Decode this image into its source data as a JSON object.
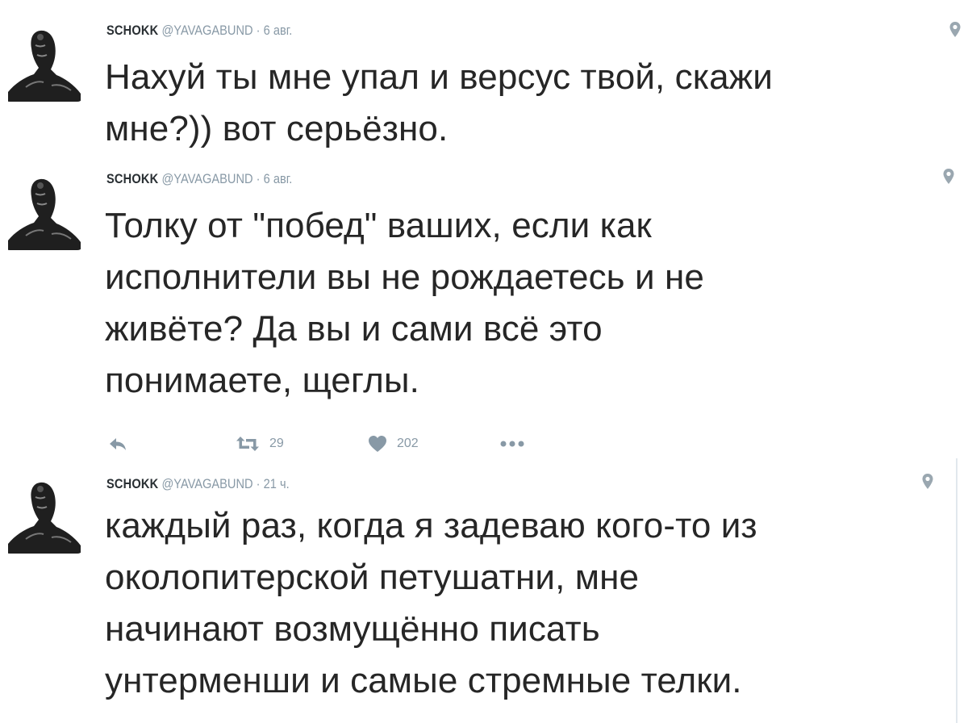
{
  "tweets": [
    {
      "name": "SCHOKK",
      "handle": "@YAVAGABUND",
      "separator": "·",
      "time": "6 авг.",
      "lines": [
        "Нахуй ты мне упал и версус твой, скажи",
        "мне?)) вот серьёзно."
      ]
    },
    {
      "name": "SCHOKK",
      "handle": "@YAVAGABUND",
      "separator": "·",
      "time": "6 авг.",
      "lines": [
        "Толку от \"побед\" ваших, если как",
        "исполнители вы не рождаетесь и не",
        "живёте? Да вы и сами всё это",
        "понимаете, щеглы."
      ],
      "actions": {
        "reply_icon": "reply-icon",
        "retweet_icon": "retweet-icon",
        "retweet_count": "29",
        "like_icon": "heart-icon",
        "like_count": "202",
        "more_icon": "more-icon"
      }
    },
    {
      "name": "SCHOKK",
      "handle": "@YAVAGABUND",
      "separator": "·",
      "time": "21 ч.",
      "lines": [
        "каждый раз, когда я задеваю кого-то из",
        "околопитерской петушатни, мне",
        "начинают возмущённо писать",
        "унтерменши и самые стремные телки."
      ]
    }
  ],
  "icons": {
    "location": "location-pin-icon",
    "avatar": "avatar"
  },
  "colors": {
    "text": "#262626",
    "meta": "#8899a6",
    "name": "#292f33",
    "action": "#8899a6",
    "thread_line": "#e1e8ed"
  }
}
